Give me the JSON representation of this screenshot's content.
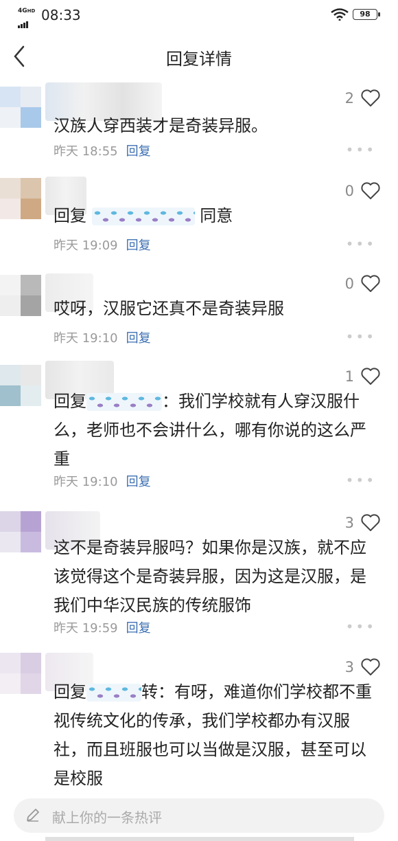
{
  "status": {
    "network": "4G",
    "network_sub": "HD",
    "time": "08:33",
    "battery": "98"
  },
  "header": {
    "title": "回复详情"
  },
  "comments": [
    {
      "text": "汉族人穿西装才是奇装异服。",
      "time": "昨天 18:55",
      "reply": "回复",
      "likes": "2"
    },
    {
      "text": "回复 同意",
      "time": "昨天 19:09",
      "reply": "回复",
      "likes": "0"
    },
    {
      "text": "哎呀，汉服它还真不是奇装异服",
      "time": "昨天 19:10",
      "reply": "回复",
      "likes": "0"
    },
    {
      "text_pre": "回复",
      "text_post": "：我们学校就有人穿汉服什么，老师也不会讲什么，哪有你说的这么严重",
      "time": "昨天 19:10",
      "reply": "回复",
      "likes": "1"
    },
    {
      "text": "这不是奇装异服吗？如果你是汉族，就不应该觉得这个是奇装异服，因为这是汉服，是我们中华汉民族的传统服饰",
      "time": "昨天 19:59",
      "reply": "回复",
      "likes": "3"
    },
    {
      "text_pre": "回复",
      "text_post": "转：有呀，难道你们学校都不重视传统文化的传承，我们学校都办有汉服社，而且班服也可以当做是汉服，甚至可以是校服",
      "likes": "3"
    }
  ],
  "input": {
    "placeholder": "献上你的一条热评"
  },
  "colors": {
    "reply_link": "#3c6fb2",
    "meta": "#9a9a9a"
  }
}
